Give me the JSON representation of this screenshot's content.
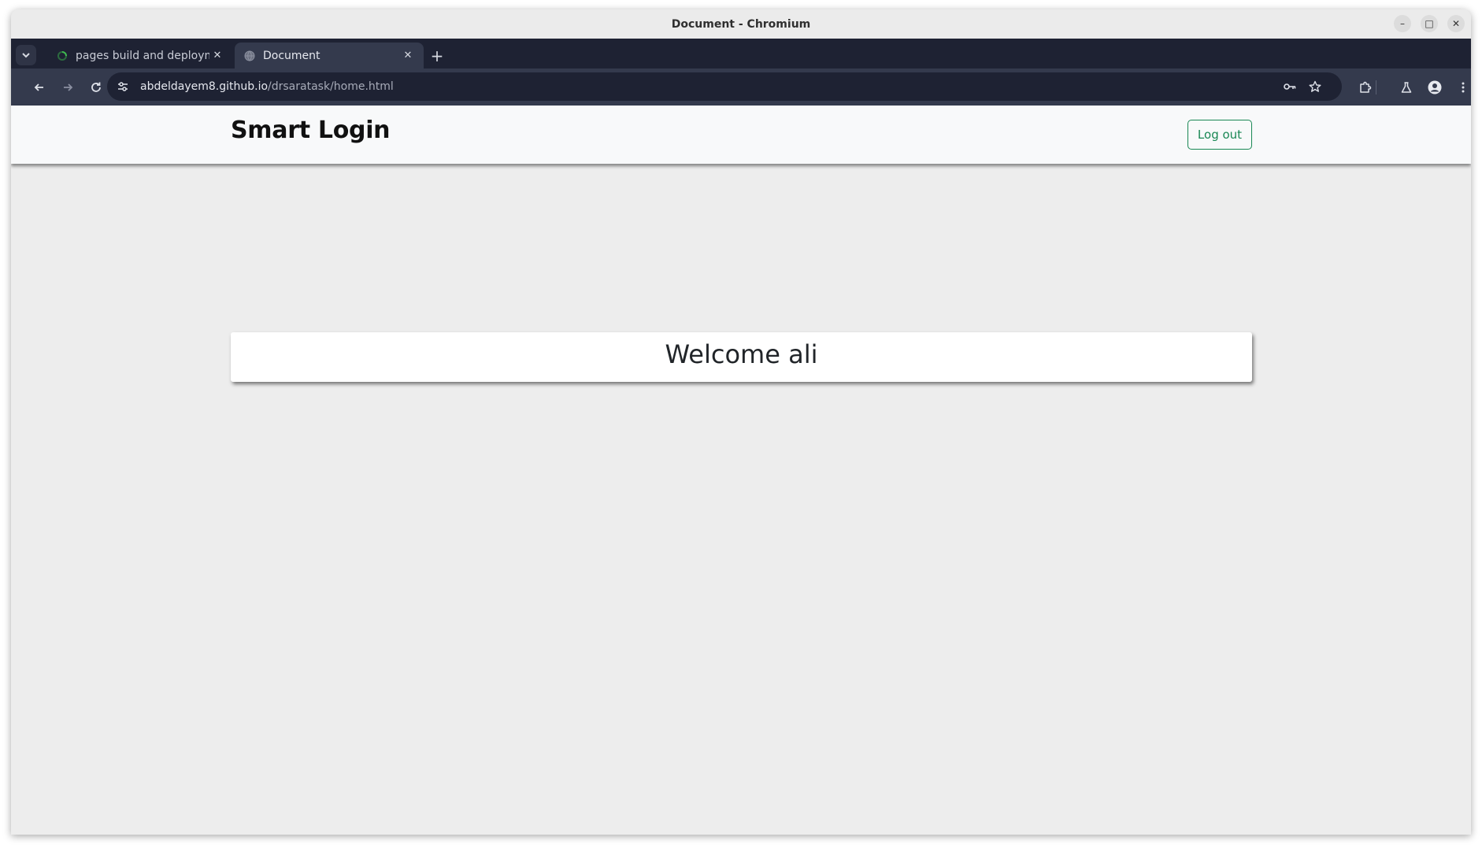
{
  "window": {
    "title": "Document - Chromium",
    "controls": {
      "minimize": "–",
      "maximize": "□",
      "close": "✕"
    }
  },
  "tabs": [
    {
      "title": "pages build and deploym",
      "favicon": "spinner-icon",
      "close": "✕",
      "active": false
    },
    {
      "title": "Document",
      "favicon": "globe-icon",
      "close": "✕",
      "active": true
    }
  ],
  "new_tab_label": "+",
  "address_bar": {
    "host": "abdeldayem8.github.io",
    "path": "/drsaratask/home.html"
  },
  "page": {
    "brand": "Smart Login",
    "logout_label": "Log out",
    "welcome_text": "Welcome ali"
  },
  "colors": {
    "accent": "#198754",
    "tabstrip": "#1e2233",
    "toolbar": "#343a4d",
    "page_bg": "#ededed"
  }
}
